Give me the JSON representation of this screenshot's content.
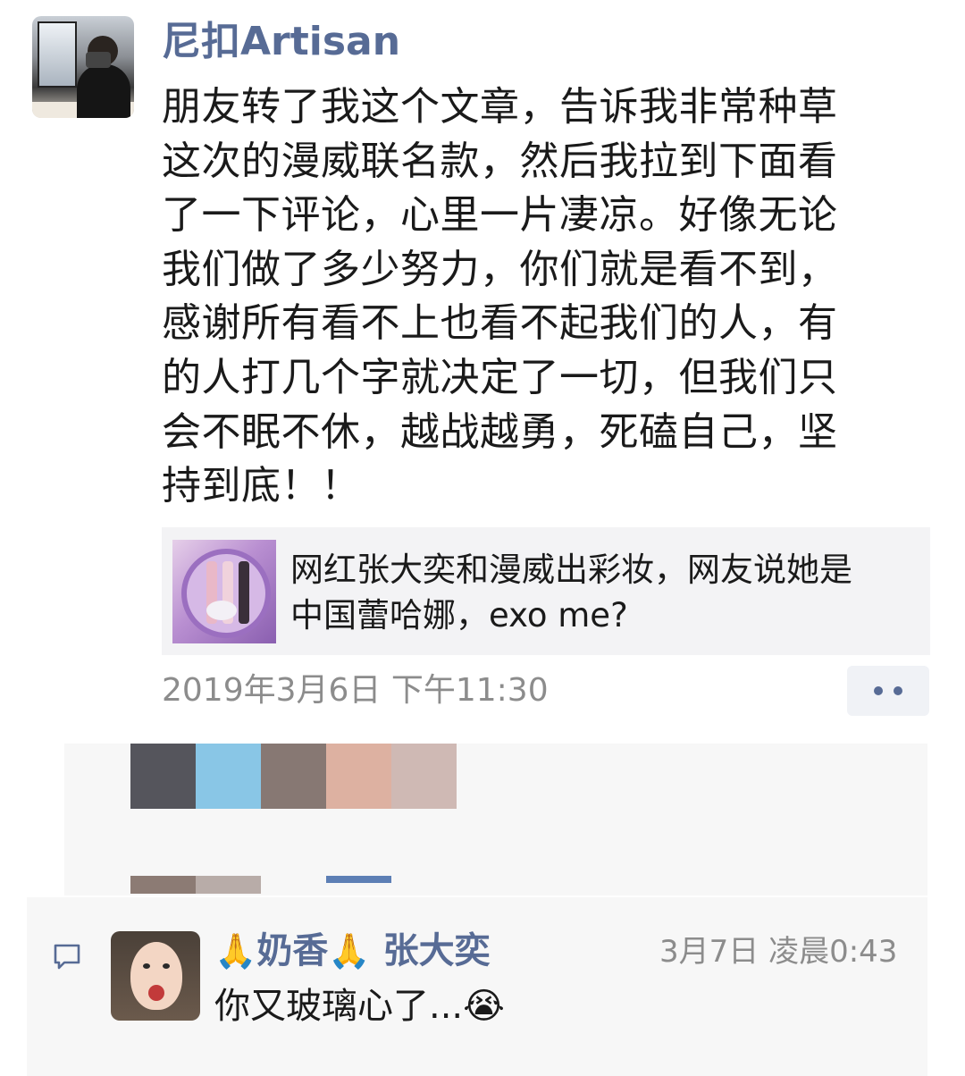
{
  "post": {
    "author": "尼扣Artisan",
    "lines": [
      "朋友转了我这个文章，告诉我非常种草",
      "这次的漫威联名款，然后我拉到下面看",
      "了一下评论，心里一片凄凉。好像无论",
      "我们做了多少努力，你们就是看不到，",
      "感谢所有看不上也看不起我们的人，有",
      "的人打几个字就决定了一切，但我们只",
      "会不眠不休，越战越勇，死磕自己，坚",
      "持到底！！"
    ],
    "timestamp": "2019年3月6日 下午11:30"
  },
  "shared_article": {
    "title_lines": [
      "网红张大奕和漫威出彩妆，网友说她是",
      "中国蕾哈娜，exo me?"
    ]
  },
  "censored_likes": {
    "colors": [
      "#55555c",
      "#89c6e6",
      "#877873",
      "#ddb1a1",
      "#cfb9b4",
      "#8c7b74",
      "#b8aca8",
      "#5d7fb5"
    ]
  },
  "comment": {
    "name_prefix_emoji": "🙏",
    "name_part": "奶香",
    "name_suffix_emoji": "🙏",
    "name_target": "张大奕",
    "time": "3月7日 凌晨0:43",
    "text": "你又玻璃心了...",
    "text_emoji": "😭",
    "icon": "comment-icon"
  },
  "colors": {
    "link_blue": "#576b95",
    "meta_gray": "#8c8c8c",
    "card_bg": "#f3f3f5",
    "section_bg": "#f7f7f7"
  }
}
